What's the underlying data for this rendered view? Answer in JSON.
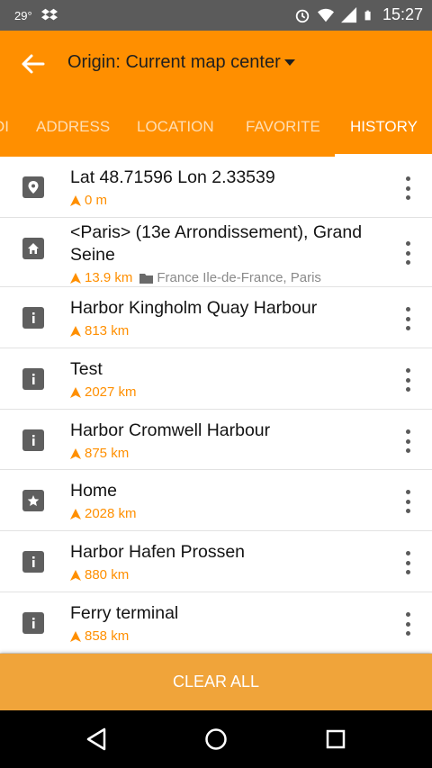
{
  "status_bar": {
    "temperature": "29°",
    "time": "15:27",
    "icons": [
      "dropbox-icon",
      "alarm-icon",
      "wifi-icon",
      "signal-icon",
      "battery-icon"
    ]
  },
  "app_bar": {
    "back_icon": "arrow-back-icon",
    "title": "Origin: Current map center",
    "dropdown_icon": "triangle-down-icon",
    "background_color": "#ff8f00"
  },
  "tabs": [
    {
      "label": "OI",
      "active": false
    },
    {
      "label": "ADDRESS",
      "active": false
    },
    {
      "label": "LOCATION",
      "active": false
    },
    {
      "label": "FAVORITE",
      "active": false
    },
    {
      "label": "HISTORY",
      "active": true
    }
  ],
  "history": [
    {
      "icon": "map-pin-icon",
      "title": "Lat 48.71596  Lon 2.33539",
      "distance": "0 m"
    },
    {
      "icon": "home-icon",
      "title": "<Paris> (13e Arrondissement), Grand Seine",
      "distance": "13.9 km",
      "folder": "France Ile-de-France, Paris"
    },
    {
      "icon": "info-icon",
      "title": "Harbor Kingholm Quay Harbour",
      "distance": "813 km"
    },
    {
      "icon": "info-icon",
      "title": "Test",
      "distance": "2027 km"
    },
    {
      "icon": "info-icon",
      "title": "Harbor Cromwell Harbour",
      "distance": "875 km"
    },
    {
      "icon": "star-icon",
      "title": "Home",
      "distance": "2028 km"
    },
    {
      "icon": "info-icon",
      "title": "Harbor Hafen Prossen",
      "distance": "880 km"
    },
    {
      "icon": "info-icon",
      "title": "Ferry terminal",
      "distance": "858 km"
    }
  ],
  "footer": {
    "clear_all_label": "CLEAR ALL"
  },
  "nav_bar": {
    "icons": [
      "back-triangle-icon",
      "home-circle-icon",
      "recents-square-icon"
    ]
  },
  "colors": {
    "accent": "#ff8f00",
    "footer": "#f0a43a",
    "distance_text": "#ff8f00"
  }
}
